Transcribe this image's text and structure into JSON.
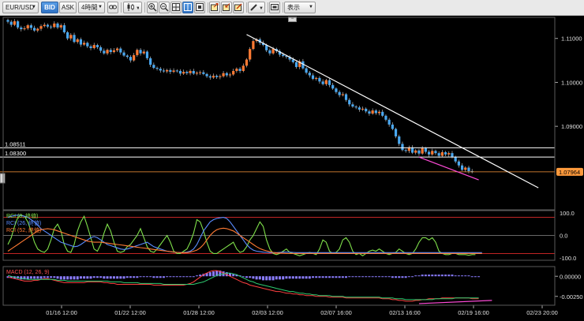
{
  "toolbar": {
    "symbol": "EUR/USD",
    "bid_label": "BID",
    "ask_label": "ASK",
    "timeframe": "4時間",
    "display_label": "表示"
  },
  "colors": {
    "bull": "#ff7a33",
    "bear": "#4aa8f0",
    "rci_short": "#7fe04a",
    "rci_mid": "#5a8cff",
    "rci_long": "#ff7a33",
    "macd_hist": "#8a7cff",
    "macd_line": "#ff4040",
    "signal_line": "#2ecc71"
  },
  "chart_data": [
    {
      "type": "line",
      "name_text": "",
      "y_ticks": [
        "1.11000",
        "1.10000",
        "1.09000"
      ],
      "y_tick_values": [
        1.11,
        1.1,
        1.09
      ],
      "ylim": [
        1.071,
        1.1148
      ],
      "h_lines": [
        {
          "label": "1.08511",
          "value": 1.08511,
          "color": "#ffffff"
        },
        {
          "label": "1.08300",
          "value": 1.083,
          "color": "#ffffff"
        },
        {
          "label": "1.07964",
          "value": 1.07964,
          "color": "#ff9a3c",
          "badge": true
        }
      ],
      "x_ticks": [
        "01/16 12:00",
        "01/22 12:00",
        "01/28 12:00",
        "02/03 12:00",
        "02/07 16:00",
        "02/13 16:00",
        "02/19 16:00",
        "02/23 20:00"
      ],
      "closes": [
        1.1138,
        1.1131,
        1.1139,
        1.1125,
        1.1121,
        1.1123,
        1.113,
        1.1124,
        1.1118,
        1.1122,
        1.1128,
        1.1131,
        1.1127,
        1.1126,
        1.1134,
        1.1125,
        1.113,
        1.1114,
        1.11,
        1.1108,
        1.1092,
        1.1098,
        1.1086,
        1.109,
        1.1082,
        1.1078,
        1.1085,
        1.108,
        1.1072,
        1.1066,
        1.1074,
        1.1069,
        1.1073,
        1.1077,
        1.1068,
        1.1061,
        1.1058,
        1.105,
        1.1062,
        1.1074,
        1.1066,
        1.107,
        1.1055,
        1.104,
        1.1033,
        1.1031,
        1.1027,
        1.1025,
        1.1028,
        1.1024,
        1.1027,
        1.1026,
        1.102,
        1.1024,
        1.1021,
        1.1026,
        1.102,
        1.1022,
        1.1023,
        1.1019,
        1.1014,
        1.1011,
        1.1015,
        1.1012,
        1.1014,
        1.1021,
        1.1016,
        1.1018,
        1.1026,
        1.1031,
        1.1026,
        1.1038,
        1.1052,
        1.1076,
        1.1094,
        1.1098,
        1.109,
        1.1085,
        1.1073,
        1.1066,
        1.1076,
        1.1071,
        1.1063,
        1.106,
        1.1058,
        1.1052,
        1.1046,
        1.1035,
        1.1048,
        1.1032,
        1.1022,
        1.1016,
        1.1008,
        1.101,
        1.1002,
        1.0996,
        1.1005,
        1.0994,
        1.0986,
        1.0978,
        1.0971,
        1.0973,
        1.096,
        1.095,
        1.0945,
        1.0943,
        1.0938,
        1.094,
        1.0934,
        1.0929,
        1.0936,
        1.093,
        1.0933,
        1.0924,
        1.0915,
        1.0904,
        1.0894,
        1.0877,
        1.086,
        1.0846,
        1.0844,
        1.0852,
        1.084,
        1.0845,
        1.0838,
        1.085,
        1.0842,
        1.0836,
        1.0844,
        1.0839,
        1.0833,
        1.0841,
        1.0836,
        1.0839,
        1.083,
        1.082,
        1.0811,
        1.0801,
        1.0806,
        1.0798,
        1.0796
      ],
      "trendlines": [
        {
          "from": [
            72,
            1.1109
          ],
          "to": [
            160,
            1.076
          ],
          "color": "#ffffff"
        },
        {
          "from": [
            124,
            1.083
          ],
          "to": [
            142,
            1.0778
          ],
          "color": "#ff4bd8"
        }
      ]
    },
    {
      "type": "line",
      "legend": [
        "RCI (9, 終値)",
        "RCI (26, 終値)",
        "RCI (52, 終値)"
      ],
      "y_ticks": [
        "100.0",
        "0.0",
        "-100.0"
      ],
      "y_tick_values": [
        100,
        0,
        -100
      ],
      "ylim": [
        -110,
        110
      ],
      "h_lines": [
        {
          "value": 80,
          "color": "#ff3030"
        },
        {
          "value": -80,
          "color": "#ff3030"
        },
        {
          "value": 0,
          "color": "#8a8a8a"
        }
      ],
      "series": [
        {
          "values": [
            -40,
            -10,
            40,
            80,
            90,
            85,
            60,
            20,
            -30,
            -60,
            -70,
            -75,
            -60,
            -20,
            30,
            50,
            20,
            -40,
            -70,
            -75,
            -40,
            20,
            60,
            85,
            40,
            -10,
            -60,
            -70,
            -40,
            10,
            50,
            20,
            -30,
            -70,
            -75,
            -70,
            -50,
            -40,
            -20,
            0,
            30,
            -10,
            -50,
            -70,
            -75,
            -60,
            -40,
            -20,
            0,
            -30,
            -70,
            -80,
            -80,
            -70,
            -60,
            -30,
            10,
            70,
            60,
            20,
            -30,
            -70,
            -80,
            -80,
            -70,
            -60,
            -50,
            -40,
            -30,
            -60,
            -75,
            -70,
            -50,
            -20,
            0,
            30,
            60,
            40,
            -20,
            -60,
            -80,
            -85,
            -80,
            -70,
            -60,
            -75,
            -80,
            -85,
            -90,
            -85,
            -80,
            -75,
            -80,
            -85,
            -60,
            -20,
            -30,
            -70,
            -80,
            -75,
            -60,
            -20,
            -10,
            -30,
            -70,
            -85,
            -80,
            -90,
            -80,
            -70,
            -65,
            -70,
            -60,
            -70,
            -80,
            -85,
            -80,
            -75,
            -60,
            -70,
            -80,
            -85,
            -80,
            -60,
            -30,
            -10,
            -10,
            -20,
            -10,
            -30,
            -70,
            -80,
            -85,
            -85,
            -80,
            -80,
            -85,
            -85,
            -85,
            -88,
            -85,
            -85
          ]
        },
        {
          "values": [
            80,
            85,
            88,
            90,
            88,
            85,
            80,
            70,
            60,
            45,
            30,
            20,
            10,
            0,
            -10,
            -20,
            -30,
            -35,
            -40,
            -45,
            -50,
            -48,
            -40,
            -30,
            -20,
            -10,
            -5,
            -10,
            -20,
            -30,
            -40,
            -45,
            -50,
            -55,
            -60,
            -62,
            -60,
            -55,
            -50,
            -45,
            -40,
            -35,
            -30,
            -40,
            -50,
            -55,
            -60,
            -65,
            -70,
            -72,
            -74,
            -75,
            -76,
            -76,
            -74,
            -70,
            -60,
            -40,
            -10,
            20,
            40,
            60,
            70,
            75,
            78,
            80,
            75,
            60,
            40,
            20,
            0,
            -20,
            -40,
            -55,
            -65,
            -70,
            -72,
            -74,
            -75,
            -76,
            -76,
            -76,
            -75,
            -74,
            -74,
            -74,
            -75,
            -76,
            -76,
            -76,
            -76,
            -76,
            -76,
            -76,
            -76,
            -76,
            -76,
            -76,
            -76,
            -76,
            -76,
            -76,
            -76,
            -76,
            -76,
            -76,
            -76,
            -76,
            -76,
            -76,
            -76,
            -76,
            -76,
            -76,
            -76,
            -76,
            -76,
            -76,
            -76,
            -76,
            -76,
            -76,
            -76,
            -76,
            -76,
            -76,
            -76,
            -76,
            -76,
            -76,
            -76,
            -76,
            -76,
            -76,
            -76,
            -76,
            -76,
            -76,
            -76,
            -76,
            -76,
            -76,
            -76,
            -76
          ]
        },
        {
          "values": [
            -70,
            -60,
            -50,
            -40,
            -30,
            -20,
            -10,
            0,
            10,
            20,
            25,
            28,
            30,
            28,
            25,
            20,
            15,
            10,
            5,
            0,
            -5,
            -10,
            -15,
            -20,
            -25,
            -28,
            -30,
            -30,
            -30,
            -32,
            -34,
            -36,
            -38,
            -40,
            -42,
            -44,
            -46,
            -48,
            -50,
            -52,
            -54,
            -56,
            -58,
            -60,
            -62,
            -64,
            -66,
            -68,
            -70,
            -72,
            -74,
            -75,
            -76,
            -77,
            -76,
            -74,
            -70,
            -65,
            -55,
            -40,
            -20,
            0,
            15,
            25,
            30,
            32,
            30,
            25,
            20,
            10,
            0,
            -10,
            -20,
            -30,
            -40,
            -50,
            -58,
            -64,
            -68,
            -72,
            -75,
            -77,
            -78,
            -79,
            -80,
            -80,
            -80,
            -80,
            -80,
            -80,
            -80,
            -80,
            -80,
            -80,
            -80,
            -80,
            -80,
            -80,
            -80,
            -80,
            -80,
            -80,
            -80,
            -80,
            -80,
            -80,
            -80,
            -80,
            -80,
            -80,
            -80,
            -80,
            -80,
            -80,
            -80,
            -80,
            -80,
            -80,
            -80,
            -80,
            -80,
            -80,
            -80,
            -80,
            -80,
            -80,
            -80,
            -80,
            -80,
            -80,
            -80,
            -80,
            -80,
            -80,
            -80,
            -80,
            -80,
            -80,
            -80,
            -80,
            -80,
            -80,
            -80,
            -80
          ]
        }
      ]
    },
    {
      "type": "bar",
      "legend": "MACD (12, 26, 9)",
      "y_ticks": [
        "0.00000",
        "-0.00250"
      ],
      "y_tick_values": [
        0,
        -0.0025
      ],
      "ylim": [
        -0.0036,
        0.0012
      ],
      "histogram": [
        -0.0002,
        -0.0002,
        -0.0003,
        -0.0003,
        -0.0004,
        -0.0004,
        -0.0004,
        -0.0003,
        -0.0003,
        -0.0003,
        -0.0003,
        -0.0002,
        -0.0002,
        -0.0002,
        -0.0002,
        -0.0003,
        -0.0004,
        -0.0004,
        -0.0004,
        -0.0004,
        -0.0004,
        -0.0004,
        -0.0003,
        -0.0003,
        -0.0003,
        -0.0003,
        -0.0002,
        -0.0002,
        -0.0002,
        -0.0003,
        -0.0003,
        -0.0003,
        -0.0003,
        -0.0003,
        -0.0003,
        -0.0003,
        -0.0002,
        -0.0002,
        -0.0002,
        -0.0002,
        -0.0001,
        -0.0001,
        -0.0001,
        -0.0001,
        -0.0002,
        -0.0002,
        -0.0002,
        -0.0002,
        -0.0001,
        -0.0001,
        -0.0001,
        -0.0001,
        -0.0001,
        -0.0001,
        -0.0001,
        -0.0001,
        -0.0001,
        0.0001,
        0.0002,
        0.0003,
        0.0004,
        0.0005,
        0.0006,
        0.0007,
        0.0007,
        0.0006,
        0.0005,
        0.0004,
        0.0003,
        0.0002,
        0.0001,
        -0.0001,
        -0.0002,
        -0.0002,
        -0.0003,
        -0.0004,
        -0.0004,
        -0.0005,
        -0.0005,
        -0.0005,
        -0.0005,
        -0.0004,
        -0.0004,
        -0.0004,
        -0.0003,
        -0.0003,
        -0.0003,
        -0.0003,
        -0.0003,
        -0.0003,
        -0.0003,
        -0.0003,
        -0.0002,
        -0.0002,
        -0.0002,
        -0.0002,
        -0.0002,
        -0.0002,
        -0.0002,
        -0.0002,
        -0.0002,
        -0.0002,
        -0.0002,
        -0.0001,
        -0.0001,
        -0.0001,
        -0.0001,
        -0.0001,
        -0.0001,
        -0.0001,
        -0.0001,
        -0.0001,
        -0.0001,
        -0.0001,
        -0.0001,
        -0.0001,
        -0.0002,
        -0.0002,
        -0.0002,
        -0.0002,
        -0.0002,
        -0.0001,
        -0.0001,
        0.0001,
        0.0001,
        0.0002,
        0.0002,
        0.0002,
        0.0002,
        0.0002,
        0.0002,
        0.0002,
        0.0002,
        0.0002,
        0.0002,
        0.0001,
        0.0001,
        0.0001,
        0.0001,
        0.0001,
        -0.0001,
        -0.0001,
        -0.0001
      ],
      "macd": [
        -0.0001,
        -0.0002,
        -0.0003,
        -0.0004,
        -0.0005,
        -0.0006,
        -0.0006,
        -0.0006,
        -0.0005,
        -0.0005,
        -0.0004,
        -0.0003,
        -0.0003,
        -0.0004,
        -0.0005,
        -0.0006,
        -0.0007,
        -0.0008,
        -0.0008,
        -0.0008,
        -0.0008,
        -0.0008,
        -0.0008,
        -0.0008,
        -0.0007,
        -0.0007,
        -0.0007,
        -0.0007,
        -0.0007,
        -0.0008,
        -0.0008,
        -0.0009,
        -0.0009,
        -0.001,
        -0.001,
        -0.001,
        -0.001,
        -0.001,
        -0.001,
        -0.001,
        -0.001,
        -0.001,
        -0.001,
        -0.001,
        -0.0011,
        -0.0011,
        -0.0011,
        -0.0011,
        -0.0011,
        -0.0011,
        -0.0011,
        -0.0011,
        -0.0011,
        -0.0011,
        -0.001,
        -0.0009,
        -0.0007,
        -0.0004,
        -0.0001,
        0.0002,
        0.0004,
        0.0006,
        0.0007,
        0.0007,
        0.0006,
        0.0004,
        0.0002,
        0.0,
        -0.0002,
        -0.0004,
        -0.0006,
        -0.0008,
        -0.0009,
        -0.0011,
        -0.0012,
        -0.0013,
        -0.0014,
        -0.0015,
        -0.0016,
        -0.0017,
        -0.0018,
        -0.0019,
        -0.0019,
        -0.002,
        -0.0021,
        -0.0021,
        -0.0022,
        -0.0022,
        -0.0023,
        -0.0023,
        -0.0024,
        -0.0024,
        -0.0024,
        -0.0025,
        -0.0025,
        -0.0025,
        -0.0025,
        -0.0026,
        -0.0026,
        -0.0026,
        -0.0026,
        -0.0026,
        -0.0027,
        -0.0027,
        -0.0027,
        -0.0027,
        -0.0027,
        -0.0027,
        -0.0027,
        -0.0027,
        -0.0027,
        -0.0027,
        -0.0027,
        -0.0028,
        -0.0028,
        -0.0028,
        -0.0029,
        -0.0029,
        -0.003,
        -0.003,
        -0.0031,
        -0.0031,
        -0.0031,
        -0.003,
        -0.003,
        -0.0029,
        -0.0029,
        -0.0028,
        -0.0028,
        -0.0028,
        -0.0028,
        -0.0027,
        -0.0027,
        -0.0027,
        -0.0027,
        -0.0027,
        -0.0027,
        -0.0027,
        -0.0027,
        -0.0027,
        -0.0028,
        -0.0028,
        -0.0028
      ],
      "signal": [
        0.0001,
        0.0,
        -0.0001,
        -0.0002,
        -0.0003,
        -0.0003,
        -0.0004,
        -0.0004,
        -0.0004,
        -0.0004,
        -0.0004,
        -0.0004,
        -0.0004,
        -0.0004,
        -0.0004,
        -0.0005,
        -0.0005,
        -0.0005,
        -0.0006,
        -0.0006,
        -0.0006,
        -0.0006,
        -0.0006,
        -0.0006,
        -0.0006,
        -0.0006,
        -0.0006,
        -0.0006,
        -0.0006,
        -0.0006,
        -0.0006,
        -0.0007,
        -0.0007,
        -0.0007,
        -0.0007,
        -0.0008,
        -0.0008,
        -0.0008,
        -0.0008,
        -0.0008,
        -0.0009,
        -0.0009,
        -0.0009,
        -0.0009,
        -0.0009,
        -0.0009,
        -0.0009,
        -0.001,
        -0.001,
        -0.001,
        -0.001,
        -0.001,
        -0.001,
        -0.001,
        -0.001,
        -0.001,
        -0.001,
        -0.0009,
        -0.0008,
        -0.0007,
        -0.0005,
        -0.0003,
        -0.0001,
        0.0001,
        0.0002,
        0.0003,
        0.0004,
        0.0004,
        0.0003,
        0.0002,
        0.0,
        -0.0002,
        -0.0004,
        -0.0006,
        -0.0007,
        -0.0009,
        -0.001,
        -0.0011,
        -0.0012,
        -0.0013,
        -0.0014,
        -0.0015,
        -0.0016,
        -0.0017,
        -0.0018,
        -0.0019,
        -0.0019,
        -0.002,
        -0.0021,
        -0.0021,
        -0.0022,
        -0.0022,
        -0.0023,
        -0.0023,
        -0.0024,
        -0.0024,
        -0.0024,
        -0.0024,
        -0.0025,
        -0.0025,
        -0.0025,
        -0.0025,
        -0.0026,
        -0.0026,
        -0.0026,
        -0.0026,
        -0.0026,
        -0.0026,
        -0.0026,
        -0.0026,
        -0.0026,
        -0.0026,
        -0.0026,
        -0.0027,
        -0.0027,
        -0.0027,
        -0.0027,
        -0.0028,
        -0.0028,
        -0.0028,
        -0.0029,
        -0.0029,
        -0.0029,
        -0.0029,
        -0.0029,
        -0.0029,
        -0.0029,
        -0.0029,
        -0.0029,
        -0.0028,
        -0.0028,
        -0.0028,
        -0.0028,
        -0.0028,
        -0.0028,
        -0.0027,
        -0.0027,
        -0.0027,
        -0.0027,
        -0.0027,
        -0.0027,
        -0.0027,
        -0.0027
      ],
      "trendline": {
        "from": [
          124,
          -0.0034
        ],
        "to": [
          146,
          -0.003
        ],
        "color": "#ff4bd8"
      }
    }
  ]
}
